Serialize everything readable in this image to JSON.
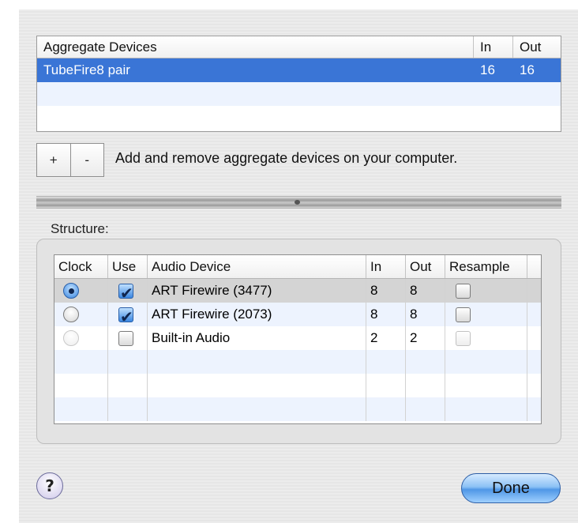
{
  "aggregate_table": {
    "headers": [
      "Aggregate Devices",
      "In",
      "Out"
    ],
    "rows": [
      {
        "name": "TubeFire8 pair",
        "in": "16",
        "out": "16"
      }
    ]
  },
  "controls": {
    "add_label": "+",
    "remove_label": "-",
    "hint": "Add and remove aggregate devices on your computer."
  },
  "structure": {
    "label": "Structure:",
    "headers": [
      "Clock",
      "Use",
      "Audio Device",
      "In",
      "Out",
      "Resample"
    ],
    "rows": [
      {
        "clock": true,
        "use": true,
        "device": "ART Firewire (3477)",
        "in": "8",
        "out": "8",
        "resample": false
      },
      {
        "clock": false,
        "use": true,
        "device": "ART Firewire (2073)",
        "in": "8",
        "out": "8",
        "resample": false
      },
      {
        "clock": false,
        "use": false,
        "device": "Built-in Audio",
        "in": "2",
        "out": "2",
        "resample": false
      }
    ]
  },
  "buttons": {
    "help_label": "?",
    "done_label": "Done"
  },
  "colors": {
    "selection": "#3a75d6",
    "stripe": "#edf3fe",
    "done_button": "#4f97e6"
  }
}
